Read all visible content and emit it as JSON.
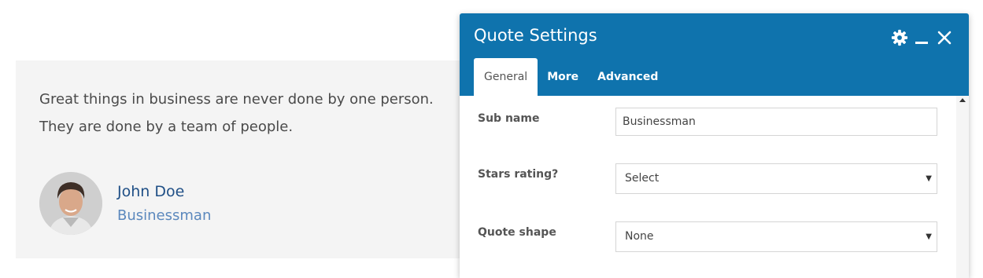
{
  "testimonial": {
    "quote": "Great things in business are never done by one person. They are done by a team of people.",
    "name": "John Doe",
    "role": "Businessman",
    "avatar_icon": "person-photo-avatar"
  },
  "dialog": {
    "title": "Quote Settings",
    "header_color": "#0f73ad",
    "icons": [
      "gear-icon",
      "minimize-icon",
      "close-icon"
    ],
    "tabs": [
      {
        "label": "General",
        "active": true
      },
      {
        "label": "More",
        "active": false
      },
      {
        "label": "Advanced",
        "active": false
      }
    ],
    "fields": {
      "sub_name": {
        "label": "Sub name",
        "value": "Businessman"
      },
      "stars_rating": {
        "label": "Stars rating?",
        "value": "Select"
      },
      "quote_shape": {
        "label": "Quote shape",
        "value": "None"
      }
    }
  }
}
